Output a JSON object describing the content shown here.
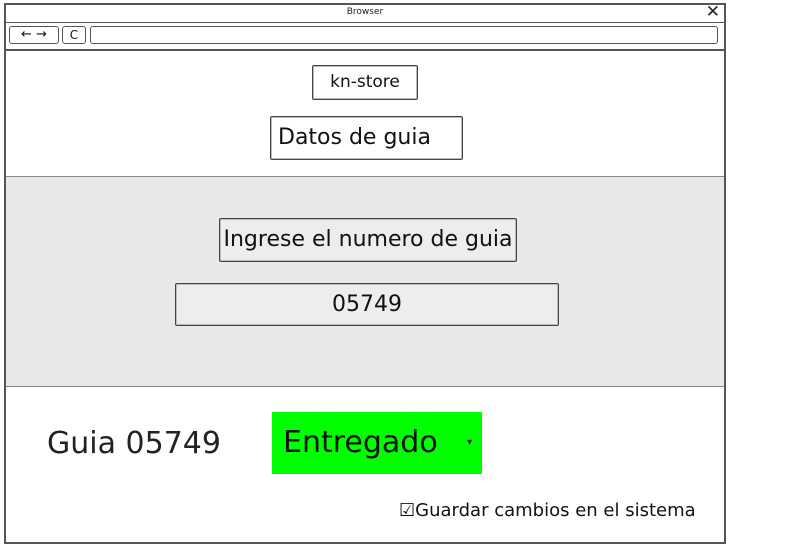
{
  "window": {
    "title": "Browser",
    "close_icon": "close-icon"
  },
  "toolbar": {
    "back_forward": "← →",
    "reload": "C",
    "address": ""
  },
  "header": {
    "store_name": "kn-store",
    "section_title": "Datos de guia"
  },
  "search": {
    "prompt": "Ingrese el numero de guia",
    "value": "05749"
  },
  "result": {
    "guide_label": "Guia 05749",
    "status_value": "Entregado",
    "status_color": "#00ff00"
  },
  "save": {
    "checkbox_glyph": "☑",
    "label": "Guardar cambios en el sistema",
    "checked": true
  }
}
